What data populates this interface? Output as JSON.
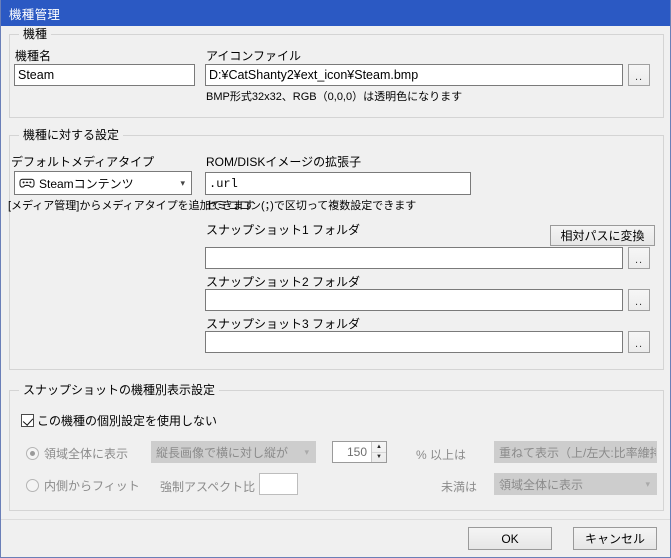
{
  "window": {
    "title": "機種管理",
    "titlebar_color": "#2b59c3",
    "background": "#f0f0f0"
  },
  "group_model": {
    "legend": "機種",
    "model_name": {
      "label": "機種名",
      "value": "Steam",
      "placeholder": ""
    },
    "icon_file": {
      "label": "アイコンファイル",
      "value": "D:¥CatShanty2¥ext_icon¥Steam.bmp",
      "placeholder": "",
      "browse_label": "..",
      "hint": "BMP形式32x32、RGB（0,0,0）は透明色になります"
    }
  },
  "group_settings": {
    "legend": "機種に対する設定",
    "media_type": {
      "label": "デフォルトメディアタイプ",
      "selected": "Steamコンテンツ",
      "icon": "gamepad-icon",
      "hint": "[メディア管理]からメディアタイプを追加できます",
      "options": [
        "Steamコンテンツ"
      ]
    },
    "rom_ext": {
      "label": "ROM/DISKイメージの拡張子",
      "value": ".url",
      "placeholder": "",
      "hint": "セミコロン(；)で区切って複数設定できます"
    },
    "relative_path_button": "相対パスに変換",
    "snapshots": [
      {
        "label": "スナップショット1 フォルダ",
        "value": "",
        "browse_label": ".."
      },
      {
        "label": "スナップショット2 フォルダ",
        "value": "",
        "browse_label": ".."
      },
      {
        "label": "スナップショット3 フォルダ",
        "value": "",
        "browse_label": ".."
      }
    ]
  },
  "group_display": {
    "legend": "スナップショットの機種別表示設定",
    "disable_individual": {
      "label": "この機種の個別設定を使用しない",
      "checked": true
    },
    "row1": {
      "radio_label": "領域全体に表示",
      "radio_selected": true,
      "condition_select": "縦長画像で横に対し縦が",
      "threshold_value": "150",
      "unit_label": "% 以上は",
      "action_select": "重ねて表示（上/左大:比率維持"
    },
    "row2": {
      "radio_label": "内側からフィット",
      "radio_selected": false,
      "aspect_label": "強制アスペクト比",
      "aspect_value": "",
      "unit_label": "未満は",
      "action_select": "領域全体に表示"
    },
    "disabled": true
  },
  "footer": {
    "ok_label": "OK",
    "cancel_label": "キャンセル"
  }
}
